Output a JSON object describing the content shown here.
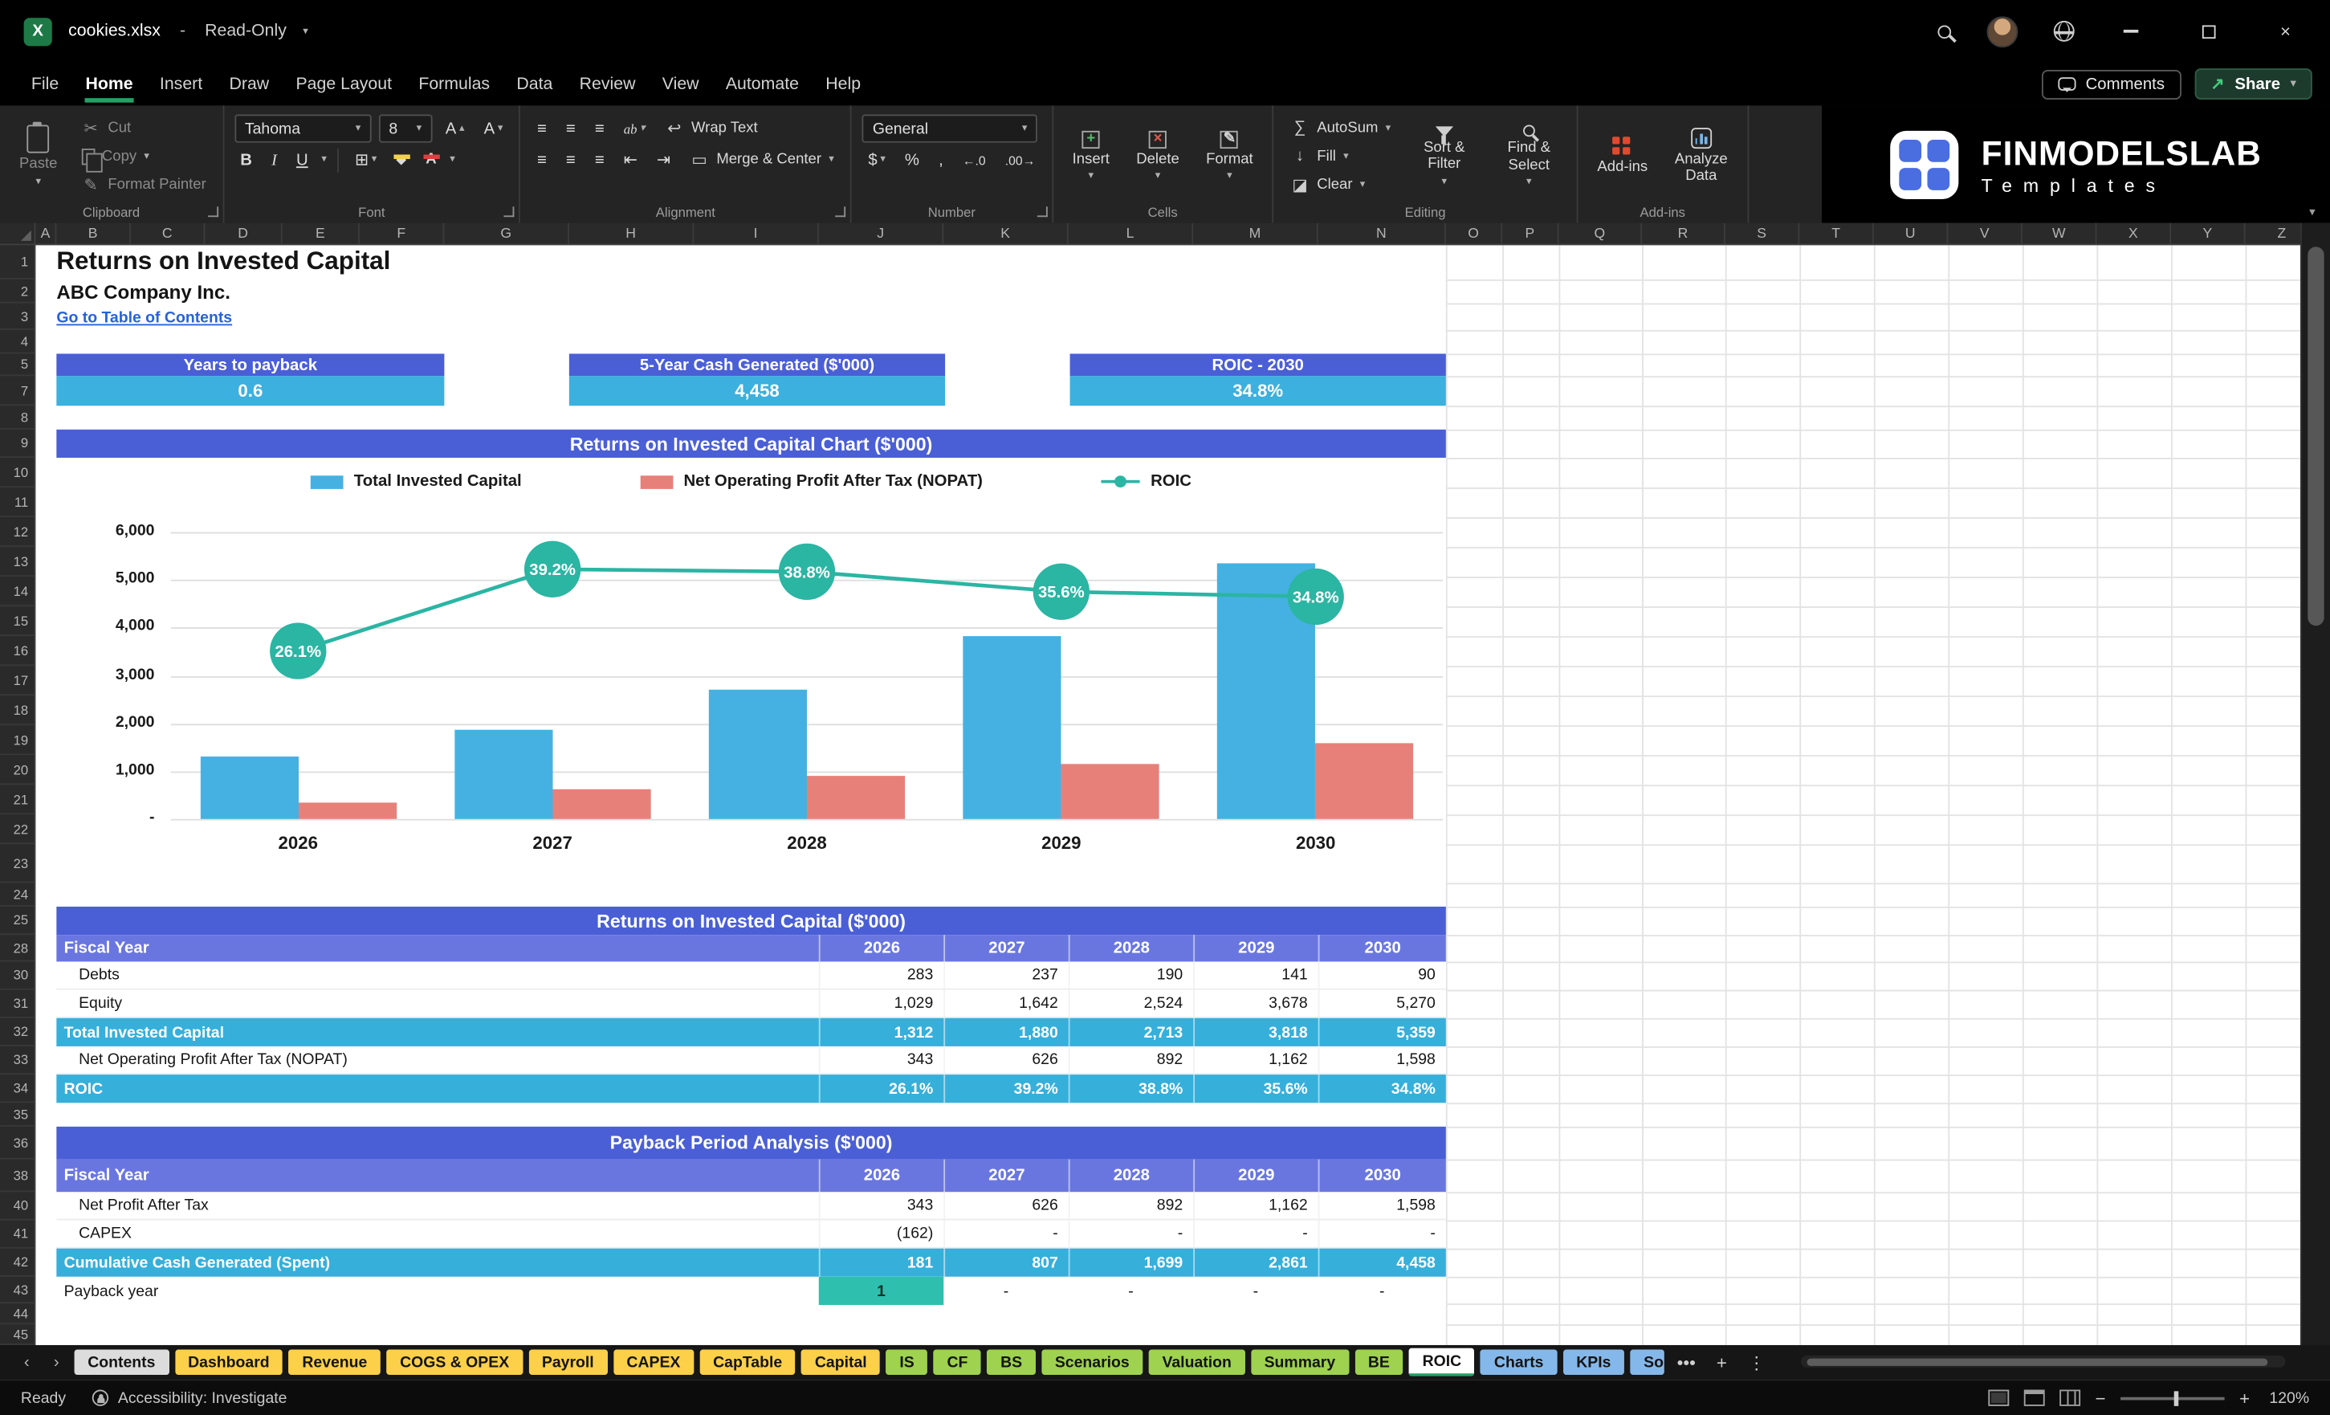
{
  "titlebar": {
    "file_name": "cookies.xlsx",
    "separator": "-",
    "mode": "Read-Only"
  },
  "menubar": {
    "items": [
      "File",
      "Home",
      "Insert",
      "Draw",
      "Page Layout",
      "Formulas",
      "Data",
      "Review",
      "View",
      "Automate",
      "Help"
    ],
    "active_item": "Home",
    "comments_label": "Comments",
    "share_label": "Share"
  },
  "ribbon": {
    "clipboard": {
      "label": "Clipboard",
      "paste": "Paste",
      "cut": "Cut",
      "copy": "Copy",
      "format_painter": "Format Painter"
    },
    "font": {
      "label": "Font",
      "font_name": "Tahoma",
      "font_size": "8",
      "bold": "B",
      "italic": "I",
      "underline": "U"
    },
    "alignment": {
      "label": "Alignment",
      "wrap_text": "Wrap Text",
      "merge_center": "Merge & Center"
    },
    "number": {
      "label": "Number",
      "format": "General",
      "currency": "$",
      "percent": "%",
      "comma": ","
    },
    "cells": {
      "label": "Cells",
      "insert": "Insert",
      "delete": "Delete",
      "format": "Format"
    },
    "editing": {
      "label": "Editing",
      "autosum": "AutoSum",
      "fill": "Fill",
      "clear": "Clear",
      "sort_filter": "Sort & Filter",
      "find_select": "Find & Select"
    },
    "addins": {
      "label": "Add-ins",
      "analyze": "Analyze Data"
    }
  },
  "brand": {
    "name": "FINMODELSLAB",
    "subtitle": "Templates"
  },
  "grid": {
    "columns": [
      "A",
      "B",
      "C",
      "D",
      "E",
      "F",
      "G",
      "H",
      "I",
      "J",
      "K",
      "L",
      "M",
      "N",
      "O",
      "P",
      "Q",
      "R",
      "S",
      "T",
      "U",
      "V",
      "W",
      "X",
      "Y",
      "Z"
    ],
    "rows": [
      "1",
      "2",
      "3",
      "4",
      "5",
      "7",
      "8",
      "9",
      "10",
      "11",
      "12",
      "13",
      "14",
      "15",
      "16",
      "17",
      "18",
      "19",
      "20",
      "21",
      "22",
      "23",
      "24",
      "25",
      "28",
      "30",
      "31",
      "32",
      "33",
      "34",
      "35",
      "36",
      "38",
      "40",
      "41",
      "42",
      "43",
      "44",
      "45"
    ]
  },
  "content": {
    "title": "Returns on Invested Capital",
    "company": "ABC Company Inc.",
    "toc_link": "Go to Table of Contents",
    "kpis": [
      {
        "label": "Years to payback",
        "value": "0.6"
      },
      {
        "label": "5-Year Cash Generated ($'000)",
        "value": "4,458"
      },
      {
        "label": "ROIC - 2030",
        "value": "34.8%"
      }
    ],
    "tables": [
      {
        "title": "Returns on Invested Capital ($'000)",
        "header": [
          "Fiscal Year",
          "2026",
          "2027",
          "2028",
          "2029",
          "2030"
        ],
        "rows": [
          {
            "label": "Debts",
            "values": [
              "283",
              "237",
              "190",
              "141",
              "90"
            ],
            "style": "normal"
          },
          {
            "label": "Equity",
            "values": [
              "1,029",
              "1,642",
              "2,524",
              "3,678",
              "5,270"
            ],
            "style": "normal"
          },
          {
            "label": "Total Invested Capital",
            "values": [
              "1,312",
              "1,880",
              "2,713",
              "3,818",
              "5,359"
            ],
            "style": "highlight"
          },
          {
            "label": "Net Operating Profit After Tax (NOPAT)",
            "values": [
              "343",
              "626",
              "892",
              "1,162",
              "1,598"
            ],
            "style": "normal"
          },
          {
            "label": "ROIC",
            "values": [
              "26.1%",
              "39.2%",
              "38.8%",
              "35.6%",
              "34.8%"
            ],
            "style": "highlight"
          }
        ]
      },
      {
        "title": "Payback Period Analysis ($'000)",
        "header": [
          "Fiscal Year",
          "2026",
          "2027",
          "2028",
          "2029",
          "2030"
        ],
        "rows": [
          {
            "label": "Net Profit After Tax",
            "values": [
              "343",
              "626",
              "892",
              "1,162",
              "1,598"
            ],
            "style": "normal"
          },
          {
            "label": "CAPEX",
            "values": [
              "(162)",
              "-",
              "-",
              "-",
              "-"
            ],
            "style": "normal"
          },
          {
            "label": "Cumulative Cash Generated (Spent)",
            "values": [
              "181",
              "807",
              "1,699",
              "2,861",
              "4,458"
            ],
            "style": "highlight"
          },
          {
            "label": "Payback year",
            "values": [
              "1",
              "-",
              "-",
              "-",
              "-"
            ],
            "style": "payback"
          }
        ]
      }
    ]
  },
  "chart_data": {
    "type": "bar+line",
    "title": "Returns on Invested Capital Chart ($'000)",
    "categories": [
      "2026",
      "2027",
      "2028",
      "2029",
      "2030"
    ],
    "series": [
      {
        "name": "Total Invested Capital",
        "type": "bar",
        "color": "#45b1e2",
        "values": [
          1312,
          1880,
          2713,
          3818,
          5359
        ]
      },
      {
        "name": "Net Operating Profit After Tax (NOPAT)",
        "type": "bar",
        "color": "#e8807a",
        "values": [
          343,
          626,
          892,
          1162,
          1598
        ]
      },
      {
        "name": "ROIC",
        "type": "line",
        "color": "#2bb5a3",
        "values_pct": [
          26.1,
          39.2,
          38.8,
          35.6,
          34.8
        ],
        "labels": [
          "26.1%",
          "39.2%",
          "38.8%",
          "35.6%",
          "34.8%"
        ]
      }
    ],
    "y_ticks": [
      "6,000",
      "5,000",
      "4,000",
      "3,000",
      "2,000",
      "1,000",
      "-"
    ],
    "ylim": [
      0,
      6000
    ],
    "legend_position": "top",
    "grid": "horizontal"
  },
  "sheet_tabs": {
    "tabs": [
      {
        "label": "Contents",
        "color": "gray"
      },
      {
        "label": "Dashboard",
        "color": "yellow"
      },
      {
        "label": "Revenue",
        "color": "yellow"
      },
      {
        "label": "COGS & OPEX",
        "color": "yellow"
      },
      {
        "label": "Payroll",
        "color": "yellow"
      },
      {
        "label": "CAPEX",
        "color": "yellow"
      },
      {
        "label": "CapTable",
        "color": "yellow"
      },
      {
        "label": "Capital",
        "color": "yellow"
      },
      {
        "label": "IS",
        "color": "green"
      },
      {
        "label": "CF",
        "color": "green"
      },
      {
        "label": "BS",
        "color": "green"
      },
      {
        "label": "Scenarios",
        "color": "green"
      },
      {
        "label": "Valuation",
        "color": "green"
      },
      {
        "label": "Summary",
        "color": "green"
      },
      {
        "label": "BE",
        "color": "green"
      },
      {
        "label": "ROIC",
        "color": "white",
        "active": true
      },
      {
        "label": "Charts",
        "color": "blue"
      },
      {
        "label": "KPIs",
        "color": "blue"
      },
      {
        "label": "So",
        "color": "blue",
        "clipped": true
      }
    ]
  },
  "statusbar": {
    "ready": "Ready",
    "accessibility": "Accessibility: Investigate",
    "zoom_level": "120%"
  }
}
